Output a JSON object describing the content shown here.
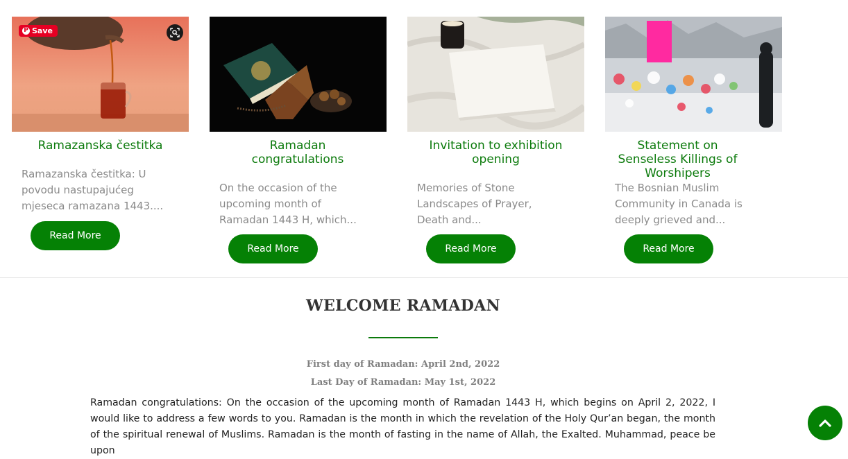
{
  "cards": [
    {
      "title": "Ramazanska čestitka",
      "excerpt": "Ramazanska čestitka: U povodu nastupajućeg mjeseca ramazana 1443....",
      "button": "Read More",
      "image": "tea-pouring-photo"
    },
    {
      "title": "Ramadan congratulations",
      "excerpt": "On the occasion of the upcoming month of Ramadan 1443 H, which...",
      "button": "Read More",
      "image": "quran-dates-photo"
    },
    {
      "title": "Invitation to exhibition opening",
      "excerpt": "Memories of Stone Landscapes of Prayer, Death and...",
      "button": "Read More",
      "image": "candle-card-photo"
    },
    {
      "title": "Statement on Senseless Killings of Worshipers",
      "excerpt": "The Bosnian Muslim Community in Canada is deeply grieved and...",
      "button": "Read More",
      "image": "memorial-photo"
    }
  ],
  "pinterest": {
    "save_label": "Save"
  },
  "welcome": {
    "title": "WELCOME RAMADAN",
    "first_day": "First day of Ramadan: April 2nd, 2022",
    "last_day": "Last Day of Ramadan: May 1st, 2022",
    "body": "Ramadan congratulations: On the occasion of the upcoming month of Ramadan 1443 H, which begins on April 2, 2022, I would like to address a few words to you. Ramadan is the month in which the revelation of the Holy Qur’an began, the month of the spiritual renewal of Muslims. Ramadan is the month of fasting in the name of Allah, the Exalted. Muhammad, peace be upon"
  },
  "colors": {
    "accent": "#058105",
    "title_green": "#0b7a0b",
    "pinterest_red": "#e60023"
  },
  "icons": {
    "scroll_top": "chevron-up-icon",
    "visual_search": "visual-search-icon"
  }
}
